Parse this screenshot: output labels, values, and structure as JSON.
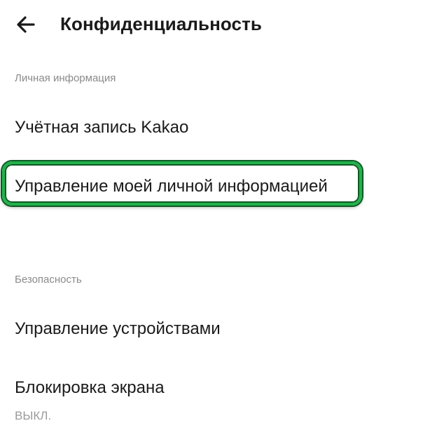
{
  "header": {
    "back_icon": "arrow-left-icon",
    "title": "Конфиденциальность"
  },
  "sections": [
    {
      "label": "Личная информация",
      "items": [
        {
          "label": "Учётная запись Kakao"
        },
        {
          "label": "Управление моей личной информацией",
          "highlighted": true
        }
      ]
    },
    {
      "label": "Безопасность",
      "items": [
        {
          "label": "Управление устройствами"
        },
        {
          "label": "Блокировка экрана",
          "value": "ВЫКЛ."
        }
      ]
    }
  ],
  "colors": {
    "highlight_border": "#22b14c",
    "highlight_outline": "#0d5a22",
    "section_label": "#8a8a8a",
    "item_value": "#9a9a9a"
  }
}
